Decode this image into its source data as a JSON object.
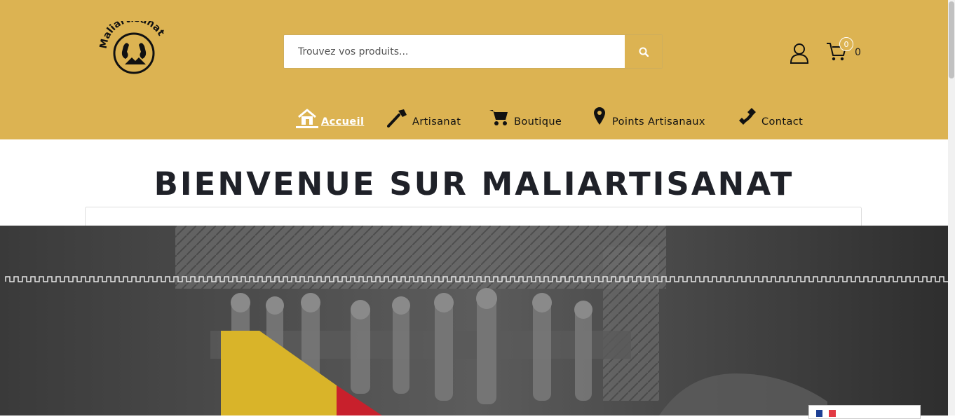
{
  "brand": {
    "logo_text": "Maliartisanat"
  },
  "search": {
    "placeholder": "Trouvez vos produits..."
  },
  "cart": {
    "badge": "0",
    "count": "0"
  },
  "nav": [
    {
      "label": "Accueil",
      "icon": "home-icon"
    },
    {
      "label": "Artisanat",
      "icon": "hammer-icon"
    },
    {
      "label": "Boutique",
      "icon": "cart-icon"
    },
    {
      "label": "Points Artisanaux",
      "icon": "map-pin-icon"
    },
    {
      "label": "Contact",
      "icon": "phone-icon"
    }
  ],
  "main": {
    "title": "BIENVENUE SUR MALIARTISANAT"
  },
  "colors": {
    "header": "#dcb352",
    "title": "#1f2128",
    "flag_yellow": "#d9b429",
    "flag_red": "#c8202c"
  }
}
